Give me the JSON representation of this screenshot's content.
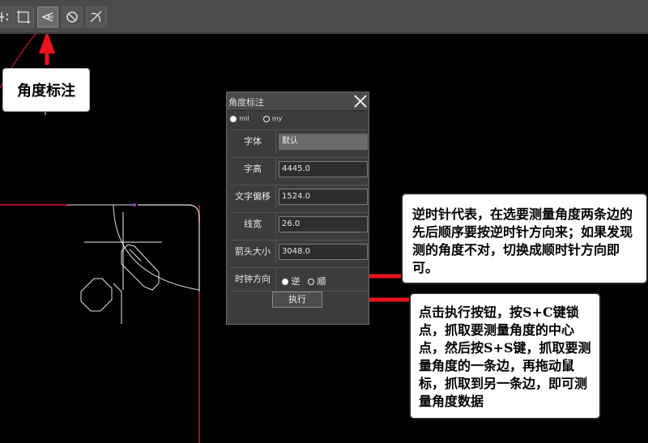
{
  "toolbar": {
    "buttons": [
      {
        "icon": "snap-icon"
      },
      {
        "icon": "frame-select-icon"
      },
      {
        "icon": "angle-dimension-icon"
      },
      {
        "icon": "no-snap-icon"
      },
      {
        "icon": "arc-trim-icon"
      }
    ]
  },
  "callout": {
    "label": "角度标注"
  },
  "dialog": {
    "title": "角度标注",
    "units": {
      "mil": "mil",
      "my": "my"
    },
    "fields": [
      {
        "label": "字体",
        "value": "默认"
      },
      {
        "label": "字高",
        "value": "4445.0"
      },
      {
        "label": "文字偏移",
        "value": "1524.0"
      },
      {
        "label": "线宽",
        "value": "26.0"
      },
      {
        "label": "箭头大小",
        "value": "3048.0"
      }
    ],
    "direction": {
      "label": "时钟方向",
      "ccw": "逆",
      "cw": "顺",
      "selected": "ccw"
    },
    "execute_label": "执行"
  },
  "notes": {
    "direction_note": "逆时针代表，在选要测量角度两条边的先后顺序要按逆时针方向来；如果发现测的角度不对，切换成顺时针方向即可。",
    "execute_note": "点击执行按钮，按S+C键锁点，抓取要测量角度的中心点，然后按S+S键，抓取要测量角度的一条边，再拖动鼠标，抓取到另一条边，即可测量角度数据"
  },
  "colors": {
    "arrow": "#e8141e",
    "canvas": "#000000",
    "board_edge": "#a0102a"
  }
}
